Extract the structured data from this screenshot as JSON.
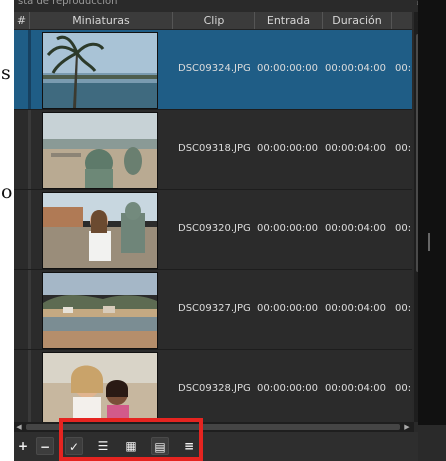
{
  "page_fragments": {
    "fragment_1": "s",
    "fragment_2": "o."
  },
  "panel": {
    "title": "sta de reproducción"
  },
  "columns": {
    "num": "#",
    "thumbnails": "Miniaturas",
    "clip": "Clip",
    "in": "Entrada",
    "duration": "Duración"
  },
  "rows": [
    {
      "clip": "DSC09324.JPG",
      "in": "00:00:00:00",
      "duration": "00:00:04:00",
      "extra": "00:",
      "selected": true
    },
    {
      "clip": "DSC09318.JPG",
      "in": "00:00:00:00",
      "duration": "00:00:04:00",
      "extra": "00:",
      "selected": false
    },
    {
      "clip": "DSC09320.JPG",
      "in": "00:00:00:00",
      "duration": "00:00:04:00",
      "extra": "00:",
      "selected": false
    },
    {
      "clip": "DSC09327.JPG",
      "in": "00:00:00:00",
      "duration": "00:00:04:00",
      "extra": "00:",
      "selected": false
    },
    {
      "clip": "DSC09328.JPG",
      "in": "00:00:00:00",
      "duration": "00:00:04:00",
      "extra": "00:",
      "selected": false
    }
  ],
  "toolbar": {
    "add": "+",
    "remove": "−",
    "check": "✓",
    "details_view": "☰",
    "tiles_view": "▦",
    "icons_view": "▤",
    "menu": "≡"
  },
  "scroll": {
    "up": "▲",
    "down": "▼",
    "left": "◀",
    "right": "▶"
  },
  "colors": {
    "selection": "#1f5d86",
    "highlight": "#e52420",
    "panel": "#2a2a2a"
  },
  "icons": [
    "plus-icon",
    "minus-icon",
    "check-icon",
    "list-icon",
    "grid-icon",
    "tiles-icon",
    "menu-icon"
  ]
}
